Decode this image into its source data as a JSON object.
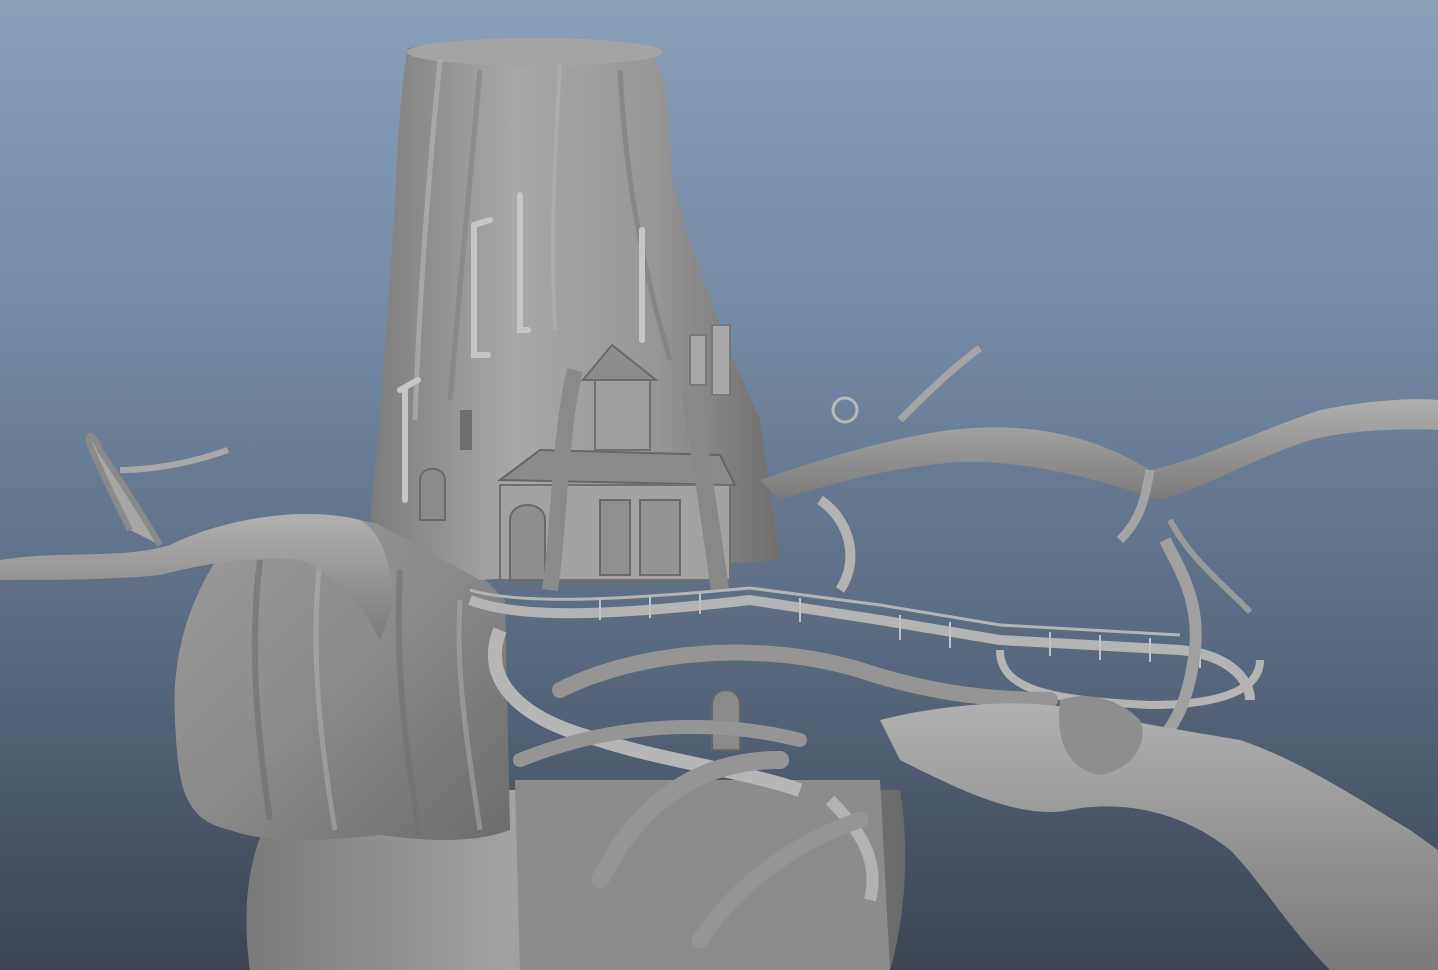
{
  "viewport": {
    "camera": "persp",
    "shading": "smooth-shaded-untextured",
    "background_top": "#8a9fb9",
    "background_bottom": "#3c4551",
    "model_color": "#9a9a9a"
  },
  "model": {
    "subject": "tree-stump-house"
  }
}
